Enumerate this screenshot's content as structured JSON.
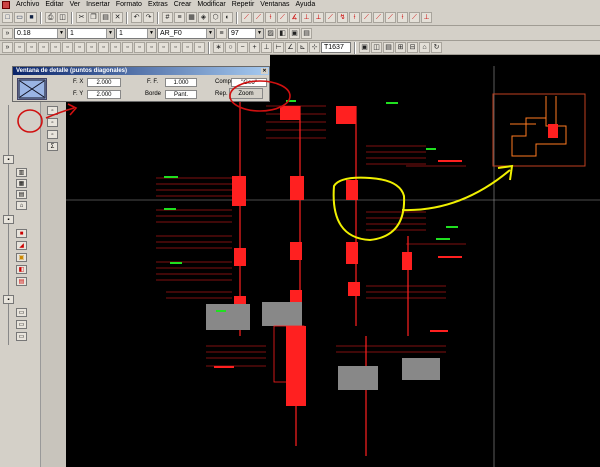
{
  "menu": [
    "Archivo",
    "Editar",
    "Ver",
    "Insertar",
    "Formato",
    "Extras",
    "Crear",
    "Modificar",
    "Repetir",
    "Ventanas",
    "Ayuda"
  ],
  "toolbar": {
    "line_weight": "0.18",
    "line_type": "1",
    "pen": "1",
    "layer": "AR_F0",
    "percent": "97",
    "coord": "T1637"
  },
  "dialog": {
    "title": "Ventana de detalle (puntos diagonales)",
    "fx_label": "F. X",
    "fx_value": "2.000",
    "fy_label": "F. Y",
    "fy_value": "2.000",
    "ff_label": "F. F.",
    "ff_value": "1.000",
    "borde_label": "Borde",
    "borde_value": "Pant.",
    "comp_label": "Comp.",
    "comp_value": "\"Geo\"",
    "rep_label": "Rep.",
    "rep_value": "Zoom"
  },
  "colors": {
    "annotation_red": "#d01010",
    "annotation_yellow": "#f0f000",
    "drawing_red": "#ff2020",
    "drawing_green": "#20e020",
    "canvas_bg": "#000000"
  }
}
